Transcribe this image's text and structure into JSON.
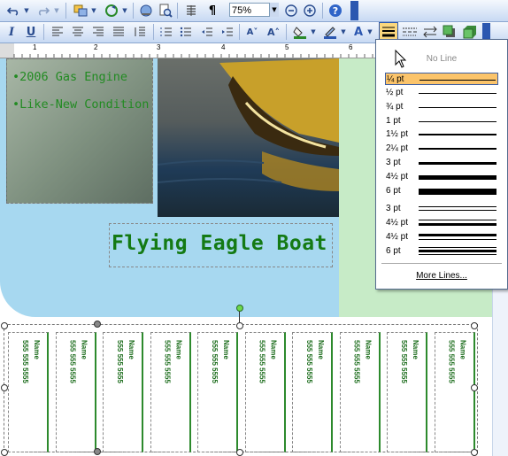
{
  "toolbar_standard": {
    "zoom": "75%",
    "paragraph_mark": "¶",
    "icons": [
      "undo-icon",
      "redo-icon",
      "arrange-icon",
      "rotate-icon",
      "hyperlink-icon",
      "print-preview-icon",
      "columns-icon",
      "show-formatting-icon",
      "zoom-out-icon",
      "zoom-in-icon",
      "help-icon"
    ]
  },
  "toolbar_formatting": {
    "italic": "I",
    "underline": "U",
    "font_color_letter": "A",
    "icons": [
      "align-left-icon",
      "align-center-icon",
      "align-right-icon",
      "justify-icon",
      "line-spacing-icon",
      "numbering-icon",
      "bullets-icon",
      "decrease-indent-icon",
      "increase-indent-icon",
      "decrease-font-icon",
      "increase-font-icon",
      "fill-color-icon",
      "line-color-icon",
      "font-color-icon",
      "line-style-icon",
      "dash-style-icon",
      "arrow-style-icon",
      "shadow-style-icon",
      "3d-style-icon"
    ]
  },
  "ruler": {
    "numbers": [
      "1",
      "2",
      "3",
      "4",
      "5",
      "6"
    ]
  },
  "document": {
    "bullets": [
      "2006 Gas Engine",
      "Like-New Condition"
    ],
    "bullet_mark": "•",
    "title": "Flying Eagle Boat",
    "tearoff_name": "Name",
    "tearoff_phone": "555 555 5555",
    "tearoff_count": 10
  },
  "line_style_menu": {
    "no_line": "No Line",
    "items": [
      {
        "label": "¼ pt",
        "weight": 0.25,
        "style": "single",
        "selected": true
      },
      {
        "label": "½ pt",
        "weight": 0.5,
        "style": "single"
      },
      {
        "label": "¾ pt",
        "weight": 0.75,
        "style": "single"
      },
      {
        "label": "1 pt",
        "weight": 1,
        "style": "single"
      },
      {
        "label": "1½ pt",
        "weight": 1.5,
        "style": "single"
      },
      {
        "label": "2¼ pt",
        "weight": 2.25,
        "style": "single"
      },
      {
        "label": "3 pt",
        "weight": 3,
        "style": "single"
      },
      {
        "label": "4½ pt",
        "weight": 4.5,
        "style": "single"
      },
      {
        "label": "6 pt",
        "weight": 6,
        "style": "single"
      },
      {
        "label": "3 pt",
        "weight": 3,
        "style": "double"
      },
      {
        "label": "4½ pt",
        "weight": 4.5,
        "style": "thin-thick"
      },
      {
        "label": "4½ pt",
        "weight": 4.5,
        "style": "thick-thin"
      },
      {
        "label": "6 pt",
        "weight": 6,
        "style": "thick-between-thin"
      }
    ],
    "more": "More Lines..."
  },
  "colors": {
    "accent": "#2b57b0",
    "title_green": "#147a14",
    "bullet_green": "#228b22",
    "selection": "#fbc46b"
  }
}
